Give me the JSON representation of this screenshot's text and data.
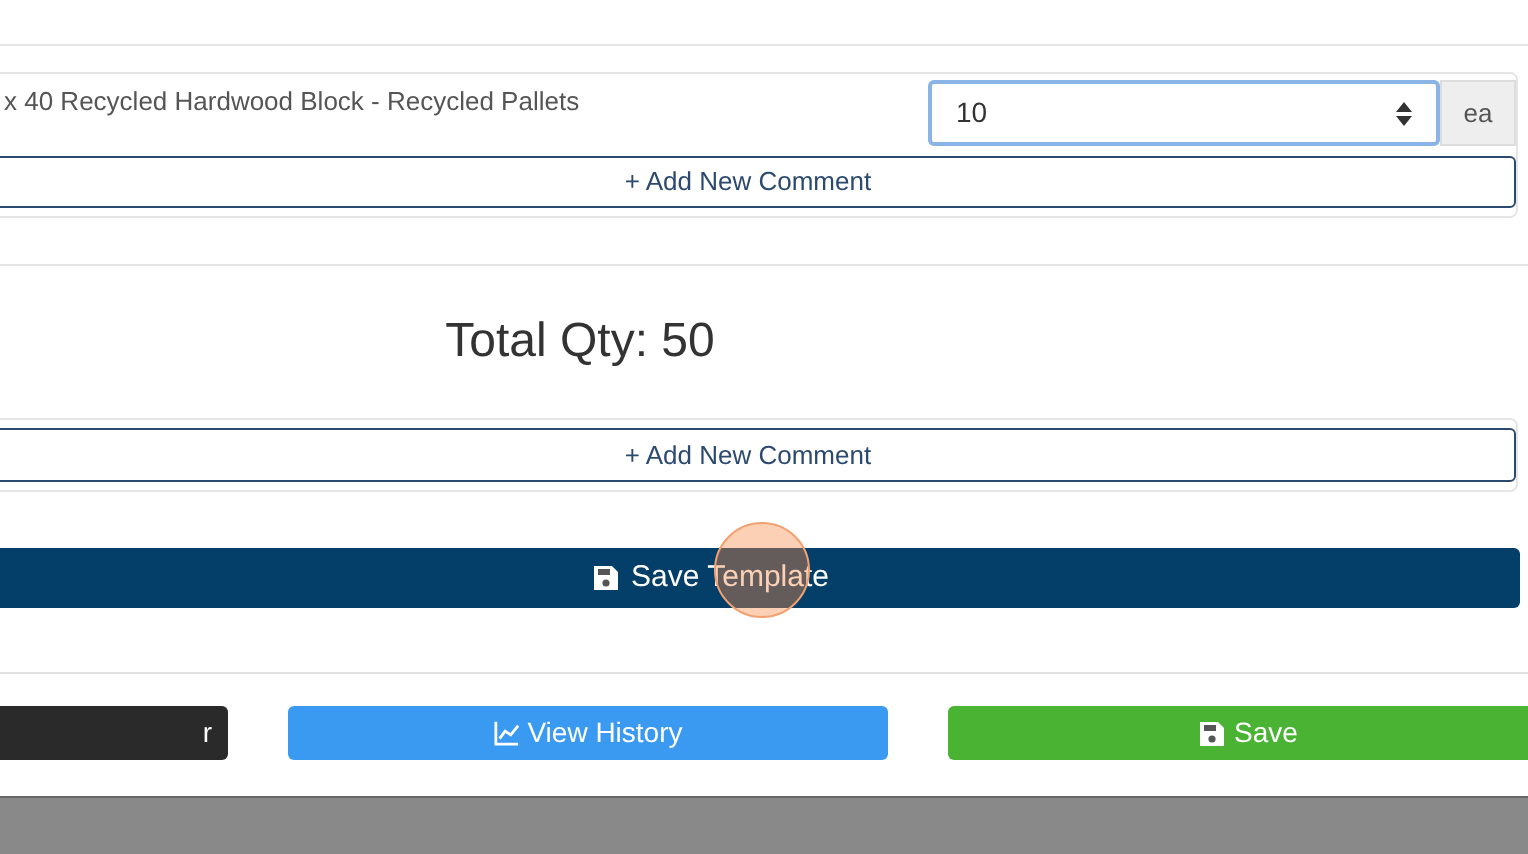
{
  "item": {
    "description": "x 40 Recycled Hardwood Block - Recycled Pallets",
    "quantity": "10",
    "unit": "ea",
    "comment_button": "+ Add New Comment"
  },
  "total": {
    "label": "Total Qty: 50"
  },
  "order_comment_button": "+ Add New Comment",
  "save_template_button": "Save Template",
  "actions": [
    {
      "kind": "dark",
      "label": "r"
    },
    {
      "kind": "history",
      "label": "View History"
    },
    {
      "kind": "save",
      "label": "Save"
    }
  ]
}
